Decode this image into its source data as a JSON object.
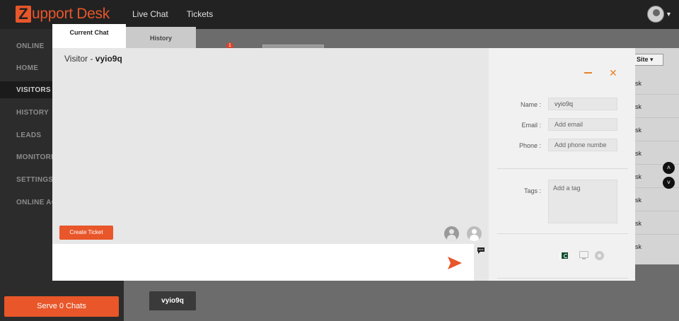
{
  "brand": {
    "logo_letter": "Z",
    "logo_text": "upport Desk",
    "accent": "#e8562a"
  },
  "topnav": {
    "items": [
      "Live Chat",
      "Tickets"
    ]
  },
  "sidebar": {
    "items": [
      "ONLINE",
      "HOME",
      "VISITORS",
      "HISTORY",
      "LEADS",
      "MONITORI",
      "SETTINGS",
      "ONLINE AG"
    ],
    "active": "VISITORS",
    "serve_button": "Serve 0 Chats"
  },
  "background": {
    "badge_count": "1",
    "site_select": "Site",
    "row_text": "sk",
    "bottom_tab": "vyio9q"
  },
  "modal": {
    "tabs": {
      "current": "Current Chat",
      "history": "History"
    },
    "visitor_label": "Visitor - ",
    "visitor_name": "vyio9q",
    "create_ticket": "Create Ticket",
    "message_input": {
      "value": "",
      "placeholder": ""
    },
    "panel": {
      "name_label": "Name :",
      "name_value": "vyio9q",
      "email_label": "Email :",
      "email_placeholder": "Add email",
      "phone_label": "Phone :",
      "phone_placeholder": "Add phone numbe",
      "tags_label": "Tags :",
      "tags_placeholder": "Add a tag"
    },
    "icons": {
      "minimize": "minimize-icon",
      "close": "close-icon",
      "send": "send-icon",
      "flag": "pakistan-flag-icon",
      "device": "monitor-icon",
      "browser": "browser-icon"
    }
  }
}
